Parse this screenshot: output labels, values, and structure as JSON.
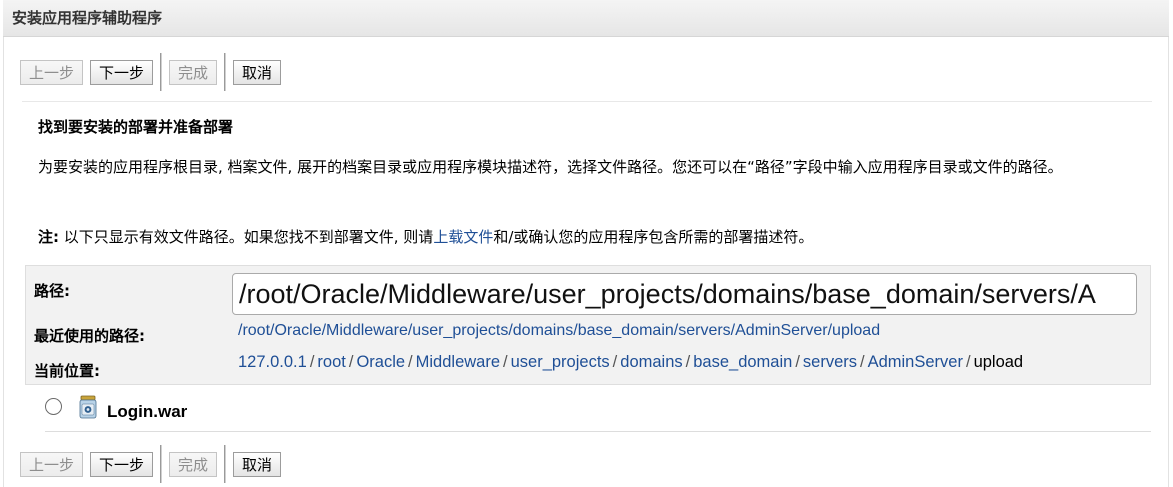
{
  "window": {
    "title": "安装应用程序辅助程序"
  },
  "toolbar": {
    "back": "上一步",
    "next": "下一步",
    "finish": "完成",
    "cancel": "取消"
  },
  "heading": "找到要安装的部署并准备部署",
  "description": "为要安装的应用程序根目录, 档案文件, 展开的档案目录或应用程序模块描述符，选择文件路径。您还可以在“路径”字段中输入应用程序目录或文件的路径。",
  "note": {
    "label": "注:",
    "text_before": " 以下只显示有效文件路径。如果您找不到部署文件, 则请",
    "link": "上载文件",
    "text_after": "和/或确认您的应用程序包含所需的部署描述符。"
  },
  "path": {
    "label": "路径:",
    "value": "/root/Oracle/Middleware/user_projects/domains/base_domain/servers/A"
  },
  "recent": {
    "label": "最近使用的路径:",
    "link": "/root/Oracle/Middleware/user_projects/domains/base_domain/servers/AdminServer/upload"
  },
  "location": {
    "label": "当前位置:",
    "crumbs": [
      "127.0.0.1",
      "root",
      "Oracle",
      "Middleware",
      "user_projects",
      "domains",
      "base_domain",
      "servers",
      "AdminServer"
    ],
    "current": "upload",
    "separator": "/"
  },
  "file": {
    "name": "Login.war",
    "icon": "jar-file-icon",
    "selected": false
  },
  "colors": {
    "link": "#1f4f96",
    "panel": "#f2f2f2"
  }
}
